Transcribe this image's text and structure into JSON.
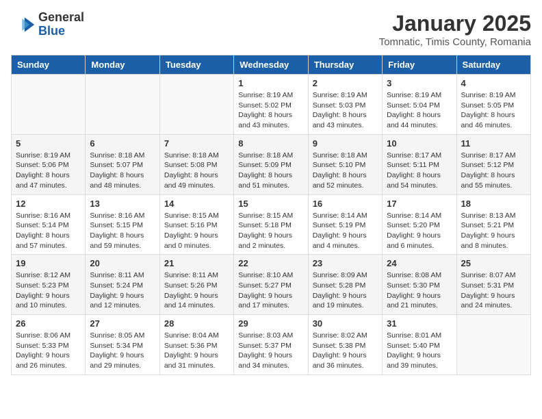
{
  "header": {
    "logo_line1": "General",
    "logo_line2": "Blue",
    "title": "January 2025",
    "subtitle": "Tomnatic, Timis County, Romania"
  },
  "weekdays": [
    "Sunday",
    "Monday",
    "Tuesday",
    "Wednesday",
    "Thursday",
    "Friday",
    "Saturday"
  ],
  "weeks": [
    [
      {
        "day": "",
        "info": ""
      },
      {
        "day": "",
        "info": ""
      },
      {
        "day": "",
        "info": ""
      },
      {
        "day": "1",
        "info": "Sunrise: 8:19 AM\nSunset: 5:02 PM\nDaylight: 8 hours and 43 minutes."
      },
      {
        "day": "2",
        "info": "Sunrise: 8:19 AM\nSunset: 5:03 PM\nDaylight: 8 hours and 43 minutes."
      },
      {
        "day": "3",
        "info": "Sunrise: 8:19 AM\nSunset: 5:04 PM\nDaylight: 8 hours and 44 minutes."
      },
      {
        "day": "4",
        "info": "Sunrise: 8:19 AM\nSunset: 5:05 PM\nDaylight: 8 hours and 46 minutes."
      }
    ],
    [
      {
        "day": "5",
        "info": "Sunrise: 8:19 AM\nSunset: 5:06 PM\nDaylight: 8 hours and 47 minutes."
      },
      {
        "day": "6",
        "info": "Sunrise: 8:18 AM\nSunset: 5:07 PM\nDaylight: 8 hours and 48 minutes."
      },
      {
        "day": "7",
        "info": "Sunrise: 8:18 AM\nSunset: 5:08 PM\nDaylight: 8 hours and 49 minutes."
      },
      {
        "day": "8",
        "info": "Sunrise: 8:18 AM\nSunset: 5:09 PM\nDaylight: 8 hours and 51 minutes."
      },
      {
        "day": "9",
        "info": "Sunrise: 8:18 AM\nSunset: 5:10 PM\nDaylight: 8 hours and 52 minutes."
      },
      {
        "day": "10",
        "info": "Sunrise: 8:17 AM\nSunset: 5:11 PM\nDaylight: 8 hours and 54 minutes."
      },
      {
        "day": "11",
        "info": "Sunrise: 8:17 AM\nSunset: 5:12 PM\nDaylight: 8 hours and 55 minutes."
      }
    ],
    [
      {
        "day": "12",
        "info": "Sunrise: 8:16 AM\nSunset: 5:14 PM\nDaylight: 8 hours and 57 minutes."
      },
      {
        "day": "13",
        "info": "Sunrise: 8:16 AM\nSunset: 5:15 PM\nDaylight: 8 hours and 59 minutes."
      },
      {
        "day": "14",
        "info": "Sunrise: 8:15 AM\nSunset: 5:16 PM\nDaylight: 9 hours and 0 minutes."
      },
      {
        "day": "15",
        "info": "Sunrise: 8:15 AM\nSunset: 5:18 PM\nDaylight: 9 hours and 2 minutes."
      },
      {
        "day": "16",
        "info": "Sunrise: 8:14 AM\nSunset: 5:19 PM\nDaylight: 9 hours and 4 minutes."
      },
      {
        "day": "17",
        "info": "Sunrise: 8:14 AM\nSunset: 5:20 PM\nDaylight: 9 hours and 6 minutes."
      },
      {
        "day": "18",
        "info": "Sunrise: 8:13 AM\nSunset: 5:21 PM\nDaylight: 9 hours and 8 minutes."
      }
    ],
    [
      {
        "day": "19",
        "info": "Sunrise: 8:12 AM\nSunset: 5:23 PM\nDaylight: 9 hours and 10 minutes."
      },
      {
        "day": "20",
        "info": "Sunrise: 8:11 AM\nSunset: 5:24 PM\nDaylight: 9 hours and 12 minutes."
      },
      {
        "day": "21",
        "info": "Sunrise: 8:11 AM\nSunset: 5:26 PM\nDaylight: 9 hours and 14 minutes."
      },
      {
        "day": "22",
        "info": "Sunrise: 8:10 AM\nSunset: 5:27 PM\nDaylight: 9 hours and 17 minutes."
      },
      {
        "day": "23",
        "info": "Sunrise: 8:09 AM\nSunset: 5:28 PM\nDaylight: 9 hours and 19 minutes."
      },
      {
        "day": "24",
        "info": "Sunrise: 8:08 AM\nSunset: 5:30 PM\nDaylight: 9 hours and 21 minutes."
      },
      {
        "day": "25",
        "info": "Sunrise: 8:07 AM\nSunset: 5:31 PM\nDaylight: 9 hours and 24 minutes."
      }
    ],
    [
      {
        "day": "26",
        "info": "Sunrise: 8:06 AM\nSunset: 5:33 PM\nDaylight: 9 hours and 26 minutes."
      },
      {
        "day": "27",
        "info": "Sunrise: 8:05 AM\nSunset: 5:34 PM\nDaylight: 9 hours and 29 minutes."
      },
      {
        "day": "28",
        "info": "Sunrise: 8:04 AM\nSunset: 5:36 PM\nDaylight: 9 hours and 31 minutes."
      },
      {
        "day": "29",
        "info": "Sunrise: 8:03 AM\nSunset: 5:37 PM\nDaylight: 9 hours and 34 minutes."
      },
      {
        "day": "30",
        "info": "Sunrise: 8:02 AM\nSunset: 5:38 PM\nDaylight: 9 hours and 36 minutes."
      },
      {
        "day": "31",
        "info": "Sunrise: 8:01 AM\nSunset: 5:40 PM\nDaylight: 9 hours and 39 minutes."
      },
      {
        "day": "",
        "info": ""
      }
    ]
  ]
}
